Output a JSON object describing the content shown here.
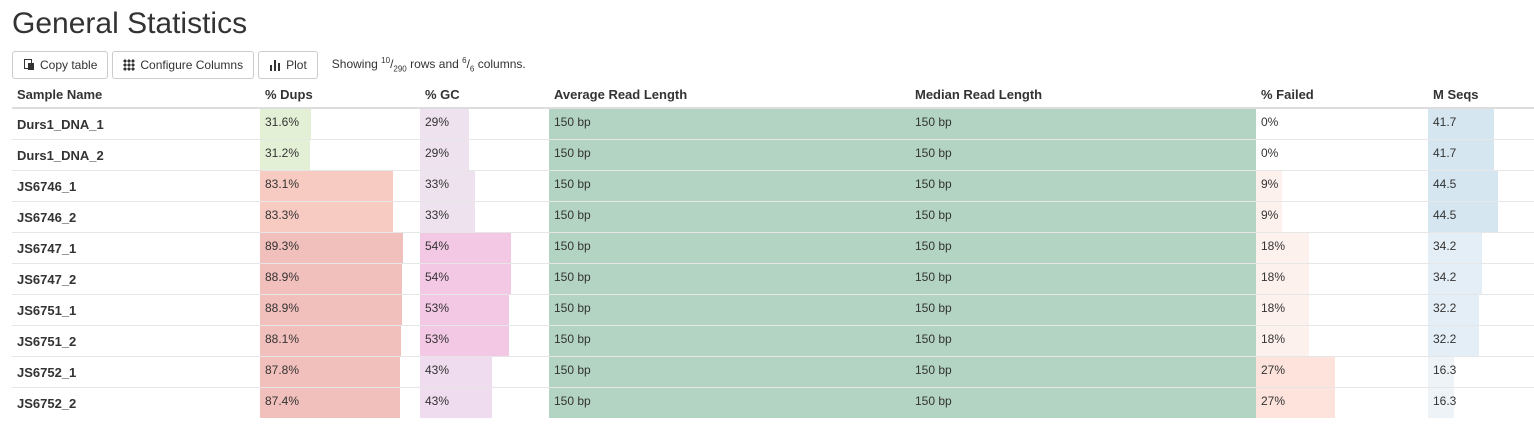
{
  "title": "General Statistics",
  "toolbar": {
    "copy_label": "Copy table",
    "configure_label": "Configure Columns",
    "plot_label": "Plot",
    "showing_prefix": "Showing ",
    "rows_shown": "10",
    "rows_total": "290",
    "rows_mid": " rows and ",
    "cols_shown": "6",
    "cols_total": "6",
    "cols_suffix": " columns."
  },
  "columns": [
    "Sample Name",
    "% Dups",
    "% GC",
    "Average Read Length",
    "Median Read Length",
    "% Failed",
    "M Seqs"
  ],
  "colors": {
    "avg_len": "#b3d4c2",
    "med_len": "#b3d4c2"
  },
  "rows": [
    {
      "name": "Durs1_DNA_1",
      "dups": "31.6%",
      "dups_v": 31.6,
      "gc": "29%",
      "gc_v": 29,
      "avg": "150 bp",
      "med": "150 bp",
      "failed": "0%",
      "failed_v": 0,
      "mseqs": "41.7",
      "mseqs_v": 41.7
    },
    {
      "name": "Durs1_DNA_2",
      "dups": "31.2%",
      "dups_v": 31.2,
      "gc": "29%",
      "gc_v": 29,
      "avg": "150 bp",
      "med": "150 bp",
      "failed": "0%",
      "failed_v": 0,
      "mseqs": "41.7",
      "mseqs_v": 41.7
    },
    {
      "name": "JS6746_1",
      "dups": "83.1%",
      "dups_v": 83.1,
      "gc": "33%",
      "gc_v": 33,
      "avg": "150 bp",
      "med": "150 bp",
      "failed": "9%",
      "failed_v": 9,
      "mseqs": "44.5",
      "mseqs_v": 44.5
    },
    {
      "name": "JS6746_2",
      "dups": "83.3%",
      "dups_v": 83.3,
      "gc": "33%",
      "gc_v": 33,
      "avg": "150 bp",
      "med": "150 bp",
      "failed": "9%",
      "failed_v": 9,
      "mseqs": "44.5",
      "mseqs_v": 44.5
    },
    {
      "name": "JS6747_1",
      "dups": "89.3%",
      "dups_v": 89.3,
      "gc": "54%",
      "gc_v": 54,
      "avg": "150 bp",
      "med": "150 bp",
      "failed": "18%",
      "failed_v": 18,
      "mseqs": "34.2",
      "mseqs_v": 34.2
    },
    {
      "name": "JS6747_2",
      "dups": "88.9%",
      "dups_v": 88.9,
      "gc": "54%",
      "gc_v": 54,
      "avg": "150 bp",
      "med": "150 bp",
      "failed": "18%",
      "failed_v": 18,
      "mseqs": "34.2",
      "mseqs_v": 34.2
    },
    {
      "name": "JS6751_1",
      "dups": "88.9%",
      "dups_v": 88.9,
      "gc": "53%",
      "gc_v": 53,
      "avg": "150 bp",
      "med": "150 bp",
      "failed": "18%",
      "failed_v": 18,
      "mseqs": "32.2",
      "mseqs_v": 32.2
    },
    {
      "name": "JS6751_2",
      "dups": "88.1%",
      "dups_v": 88.1,
      "gc": "53%",
      "gc_v": 53,
      "avg": "150 bp",
      "med": "150 bp",
      "failed": "18%",
      "failed_v": 18,
      "mseqs": "32.2",
      "mseqs_v": 32.2
    },
    {
      "name": "JS6752_1",
      "dups": "87.8%",
      "dups_v": 87.8,
      "gc": "43%",
      "gc_v": 43,
      "avg": "150 bp",
      "med": "150 bp",
      "failed": "27%",
      "failed_v": 27,
      "mseqs": "16.3",
      "mseqs_v": 16.3
    },
    {
      "name": "JS6752_2",
      "dups": "87.4%",
      "dups_v": 87.4,
      "gc": "43%",
      "gc_v": 43,
      "avg": "150 bp",
      "med": "150 bp",
      "failed": "27%",
      "failed_v": 27,
      "mseqs": "16.3",
      "mseqs_v": 16.3
    }
  ]
}
